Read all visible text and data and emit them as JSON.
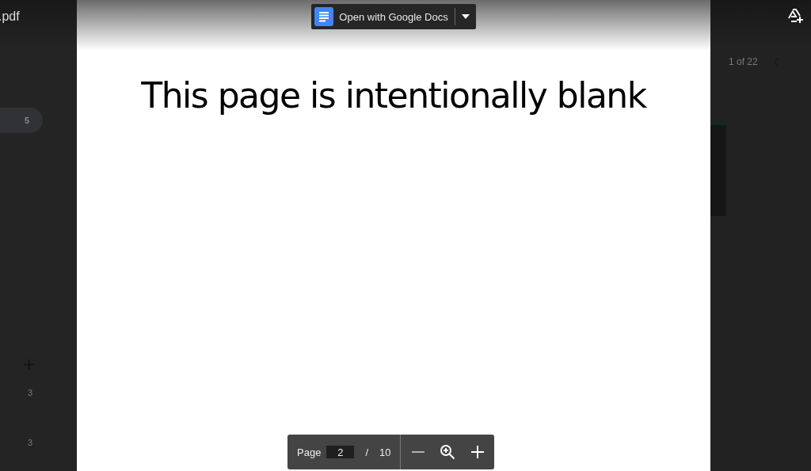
{
  "file_title": ".pdf",
  "left_panel": {
    "badge": "5",
    "numbers": [
      "3",
      "3"
    ]
  },
  "right_panel": {
    "counter": "1 of 22"
  },
  "open_with": {
    "label": "Open with Google Docs"
  },
  "page_text": "This page is intentionally blank",
  "page_toolbar": {
    "label": "Page",
    "current": "2",
    "separator": "/",
    "total": "10"
  }
}
